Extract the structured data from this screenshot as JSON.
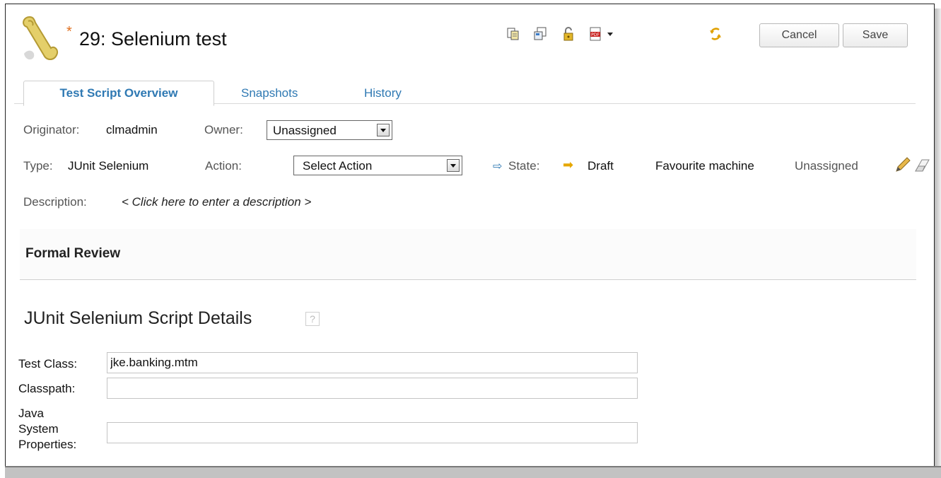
{
  "header": {
    "dirty_marker": "*",
    "title": "29: Selenium test",
    "toolbar": [
      "copy-icon",
      "duplicate-icon",
      "lock-icon",
      "pdf-icon",
      "dropdown-arrow-icon",
      "refresh-icon"
    ],
    "cancel_label": "Cancel",
    "save_label": "Save"
  },
  "tabs": [
    {
      "label": "Test Script Overview",
      "active": true
    },
    {
      "label": "Snapshots",
      "active": false
    },
    {
      "label": "History",
      "active": false
    }
  ],
  "overview": {
    "originator_label": "Originator:",
    "originator_value": "clmadmin",
    "owner_label": "Owner:",
    "owner_value": "Unassigned",
    "type_label": "Type:",
    "type_value": "JUnit Selenium",
    "action_label": "Action:",
    "action_value": "Select Action",
    "state_label": "State:",
    "state_value": "Draft",
    "favourite_label": "Favourite machine",
    "favourite_value": "Unassigned",
    "description_label": "Description:",
    "description_placeholder": "< Click here to enter a description >"
  },
  "formal_review": {
    "title": "Formal Review"
  },
  "details": {
    "title": "JUnit Selenium Script Details",
    "help_glyph": "?",
    "test_class_label": "Test Class:",
    "test_class_value": "jke.banking.mtm",
    "classpath_label": "Classpath:",
    "classpath_value": "",
    "java_props_label_1": "Java",
    "java_props_label_2": "System",
    "java_props_label_3": "Properties:",
    "java_props_value": ""
  },
  "colors": {
    "accent_link": "#2f79b3",
    "state_arrow": "#e6a700",
    "dirty_star": "#e07020"
  }
}
